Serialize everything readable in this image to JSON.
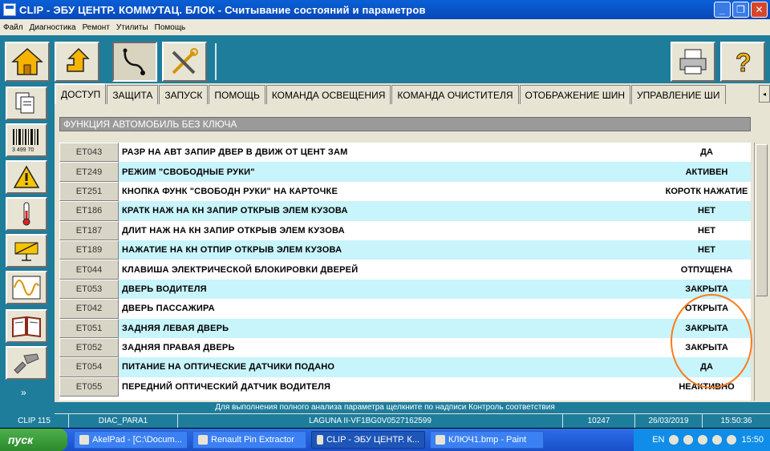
{
  "window": {
    "title": "CLIP - ЭБУ ЦЕНТР. КОММУТАЦ. БЛОК - Считывание состояний и параметров"
  },
  "menu": [
    "Файл",
    "Диагностика",
    "Ремонт",
    "Утилиты",
    "Помощь"
  ],
  "tabs": [
    "ДОСТУП",
    "ЗАЩИТА",
    "ЗАПУСК",
    "ПОМОЩЬ",
    "КОМАНДА ОСВЕЩЕНИЯ",
    "КОМАНДА ОЧИСТИТЕЛЯ",
    "ОТОБРАЖЕНИЕ ШИН",
    "УПРАВЛЕНИЕ ШИ"
  ],
  "section_title": "ФУНКЦИЯ АВТОМОБИЛЬ БЕЗ КЛЮЧА",
  "rows": [
    {
      "code": "ET043",
      "label": "РАЗР НА АВТ ЗАПИР ДВЕР В ДВИЖ ОТ ЦЕНТ ЗАМ",
      "value": "ДА"
    },
    {
      "code": "ET249",
      "label": "РЕЖИМ \"СВОБОДНЫЕ РУКИ\"",
      "value": "АКТИВЕН"
    },
    {
      "code": "ET251",
      "label": "КНОПКА ФУНК \"СВОБОДН РУКИ\" НА КАРТОЧКЕ",
      "value": "КОРОТК НАЖАТИЕ"
    },
    {
      "code": "ET186",
      "label": "КРАТК НАЖ НА КН ЗАПИР ОТКРЫВ ЭЛЕМ КУЗОВА",
      "value": "НЕТ"
    },
    {
      "code": "ET187",
      "label": "ДЛИТ НАЖ НА КН ЗАПИР ОТКРЫВ ЭЛЕМ КУЗОВА",
      "value": "НЕТ"
    },
    {
      "code": "ET189",
      "label": "НАЖАТИЕ НА КН ОТПИР ОТКРЫВ ЭЛЕМ КУЗОВА",
      "value": "НЕТ"
    },
    {
      "code": "ET044",
      "label": "КЛАВИША ЭЛЕКТРИЧЕСКОЙ БЛОКИРОВКИ ДВЕРЕЙ",
      "value": "ОТПУЩЕНА"
    },
    {
      "code": "ET053",
      "label": "ДВЕРЬ ВОДИТЕЛЯ",
      "value": "ЗАКРЫТА"
    },
    {
      "code": "ET042",
      "label": "ДВЕРЬ ПАССАЖИРА",
      "value": "ОТКРЫТА"
    },
    {
      "code": "ET051",
      "label": "ЗАДНЯЯ ЛЕВАЯ ДВЕРЬ",
      "value": "ЗАКРЫТА"
    },
    {
      "code": "ET052",
      "label": "ЗАДНЯЯ ПРАВАЯ ДВЕРЬ",
      "value": "ЗАКРЫТА"
    },
    {
      "code": "ET054",
      "label": "ПИТАНИЕ НА ОПТИЧЕСКИЕ ДАТЧИКИ ПОДАНО",
      "value": "ДА"
    },
    {
      "code": "ET055",
      "label": "ПЕРЕДНИЙ ОПТИЧЕСКИЙ ДАТЧИК ВОДИТЕЛЯ",
      "value": "НЕАКТИВНО"
    }
  ],
  "hint": "Для выполнения полного анализа параметра щелкните по надписи Контроль соответствия",
  "status": {
    "clip": "CLIP 115",
    "diag": "DIAC_PARA1",
    "vehicle": "LAGUNA II-VF1BG0V0527162599",
    "num": "10247",
    "date": "26/03/2019",
    "time": "15:50:36"
  },
  "taskbar": {
    "start": "пуск",
    "tasks": [
      "AkelPad - [C:\\Docum...",
      "Renault Pin Extractor",
      "CLIP - ЭБУ ЦЕНТР. К...",
      "КЛЮЧ1.bmp - Paint"
    ],
    "lang": "EN",
    "clock": "15:50"
  },
  "side_label": "3 499 70"
}
